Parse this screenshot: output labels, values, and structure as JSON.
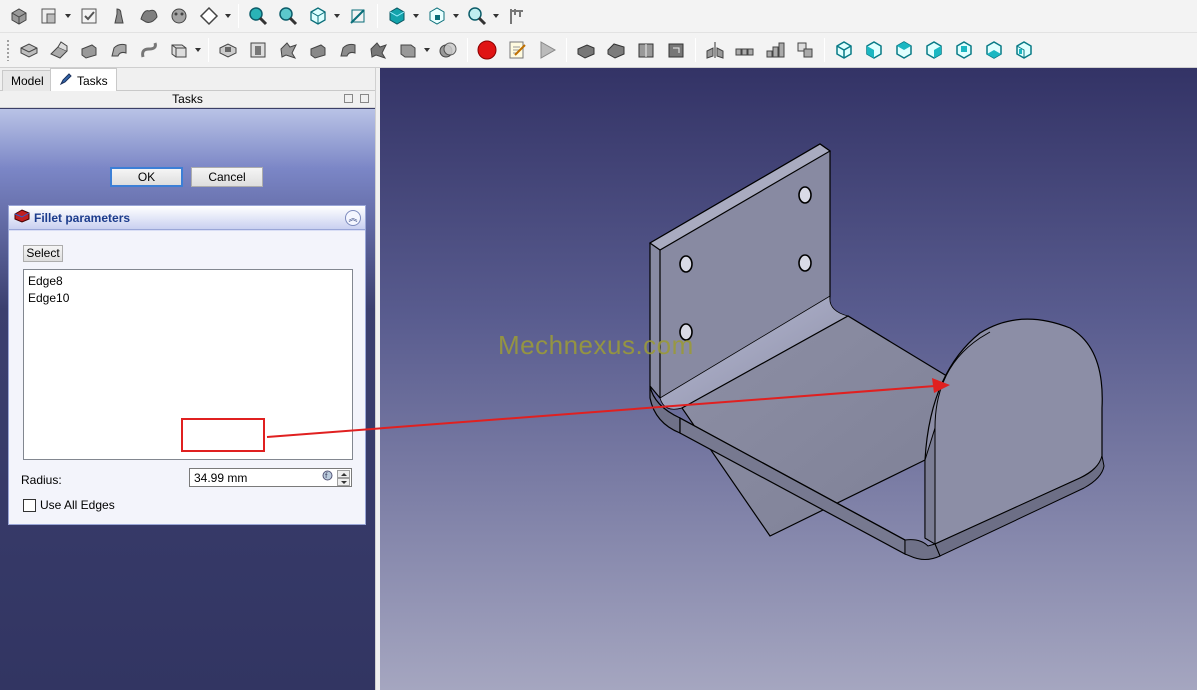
{
  "colors": {
    "viewport_top": "#333366",
    "viewport_bottom": "#a5a6c0",
    "accent": "#1c3c8c",
    "annotation": "#e02020",
    "model_face": "#8e90a6"
  },
  "toolbar1": {
    "icons": [
      "std-part-icon",
      "std-group-icon",
      "std-view-icon",
      "std-link-icon",
      "std-shape-icon",
      "std-create-icon",
      "std-diamond-icon",
      "fit-all-icon",
      "fit-selection-icon",
      "view-menu-icon",
      "measure-icon",
      "draw-style-icon",
      "bounding-box-icon",
      "zoom-icon",
      "caliper-icon"
    ]
  },
  "toolbar2": {
    "icons": [
      "additive-box-icon",
      "additive-pipe-icon",
      "additive-loft-icon",
      "subtractive-pocket-icon",
      "boolean-icon",
      "chamfer-icon",
      "datum-icon",
      "record-macro-icon",
      "edit-macro-icon",
      "run-macro-icon",
      "draft-icon",
      "mirror-icon",
      "pattern-icon",
      "hull-icon",
      "assembly-icon",
      "view-iso-icon",
      "view-front-icon",
      "view-top-icon",
      "view-right-icon",
      "view-rear-icon",
      "view-bottom-icon",
      "view-left-icon"
    ]
  },
  "tabs": {
    "model": "Model",
    "tasks": "Tasks"
  },
  "panel": {
    "title": "Tasks"
  },
  "dialog": {
    "ok_label": "OK",
    "cancel_label": "Cancel",
    "section_title": "Fillet parameters",
    "select_label": "Select",
    "edges": [
      "Edge8",
      "Edge10"
    ],
    "radius_label": "Radius:",
    "radius_value": "34.99 mm",
    "use_all_edges_label": "Use All Edges",
    "use_all_edges_checked": false
  },
  "viewport": {
    "watermark": "Mechnexus.com"
  }
}
